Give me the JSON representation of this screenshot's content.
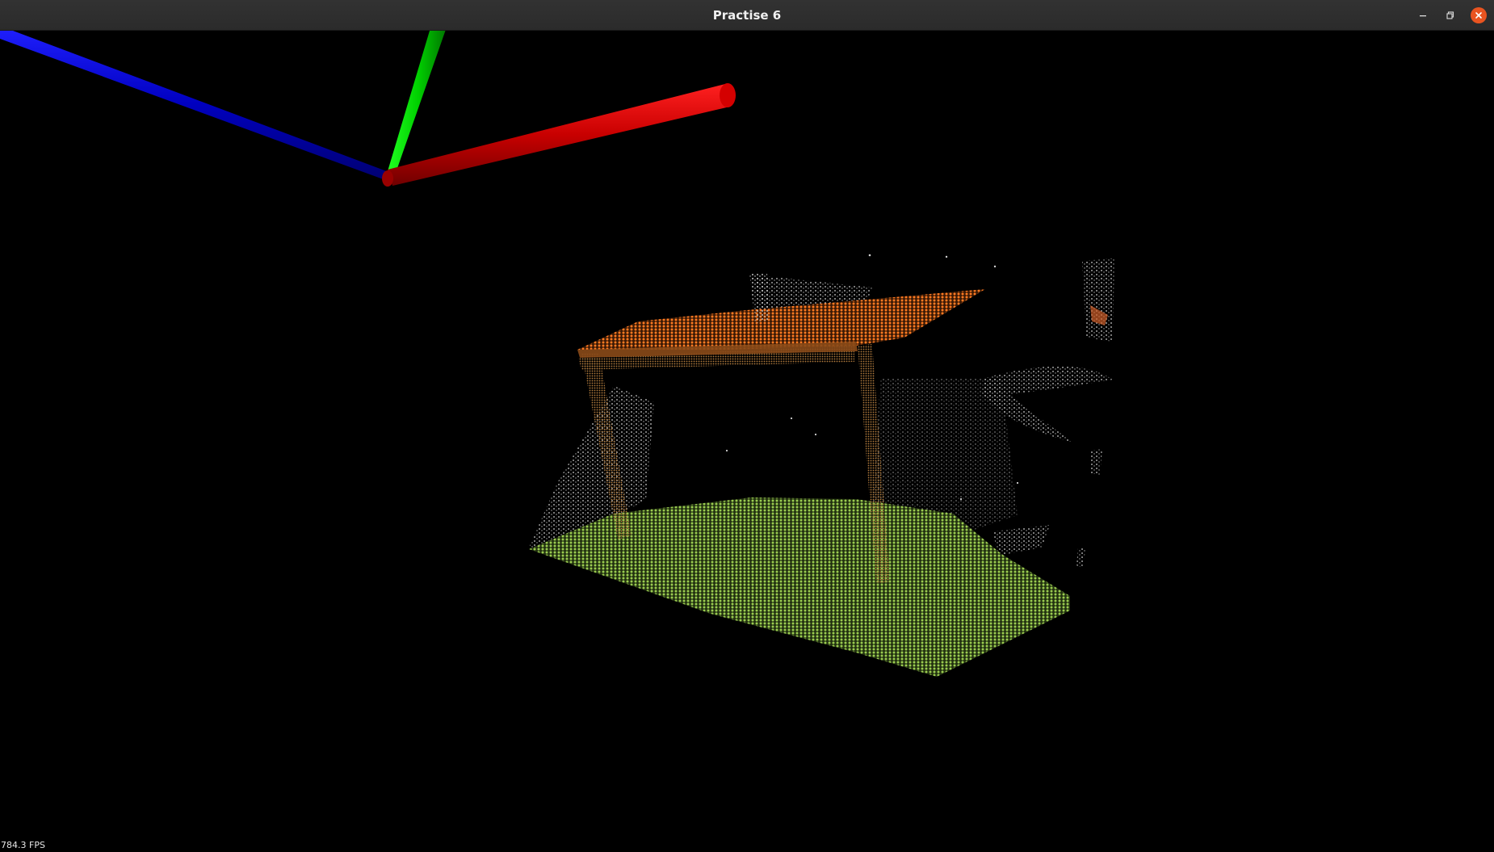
{
  "window": {
    "title": "Practise 6"
  },
  "titlebar_buttons": {
    "minimize_icon": "minimize-icon",
    "maximize_icon": "restore-icon",
    "close_icon": "close-icon"
  },
  "colors": {
    "close_button": "#e95420",
    "axis_x": "#d00000",
    "axis_y": "#00e000",
    "axis_z": "#0000c8",
    "plane_table": "#e06414",
    "plane_floor": "#8cba46",
    "points_other": "#e8e8e8"
  },
  "viewer": {
    "fps_text": "784.3 FPS"
  }
}
